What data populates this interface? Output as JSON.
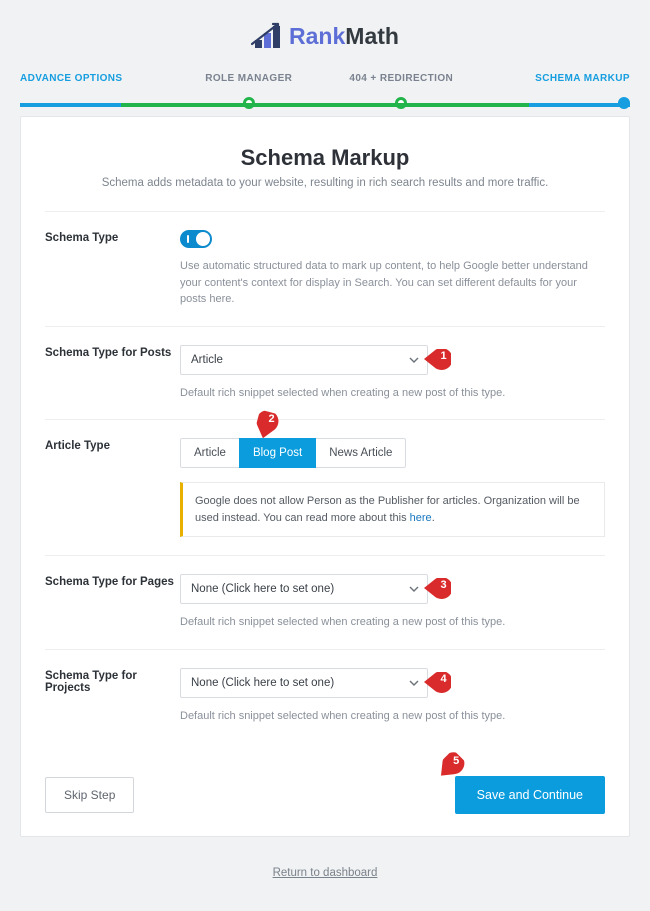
{
  "brand": {
    "first": "Rank",
    "second": "Math"
  },
  "steps": [
    {
      "label": "ADVANCE OPTIONS"
    },
    {
      "label": "ROLE MANAGER"
    },
    {
      "label": "404 + REDIRECTION"
    },
    {
      "label": "SCHEMA MARKUP"
    }
  ],
  "header": {
    "title": "Schema Markup",
    "subtitle": "Schema adds metadata to your website, resulting in rich search results and more traffic."
  },
  "sections": {
    "schema_type": {
      "label": "Schema Type",
      "help": "Use automatic structured data to mark up content, to help Google better understand your content's context for display in Search. You can set different defaults for your posts here."
    },
    "posts": {
      "label": "Schema Type for Posts",
      "value": "Article",
      "help": "Default rich snippet selected when creating a new post of this type."
    },
    "article_type": {
      "label": "Article Type",
      "options": [
        "Article",
        "Blog Post",
        "News Article"
      ],
      "notice_pre": "Google does not allow Person as the Publisher for articles. Organization will be used instead. You can read more about this ",
      "notice_link": "here",
      "notice_post": "."
    },
    "pages": {
      "label": "Schema Type for Pages",
      "value": "None (Click here to set one)",
      "help": "Default rich snippet selected when creating a new post of this type."
    },
    "projects": {
      "label": "Schema Type for Projects",
      "value": "None (Click here to set one)",
      "help": "Default rich snippet selected when creating a new post of this type."
    }
  },
  "footer": {
    "skip": "Skip Step",
    "save": "Save and Continue",
    "return": "Return to dashboard"
  },
  "callouts": [
    "1",
    "2",
    "3",
    "4",
    "5"
  ]
}
